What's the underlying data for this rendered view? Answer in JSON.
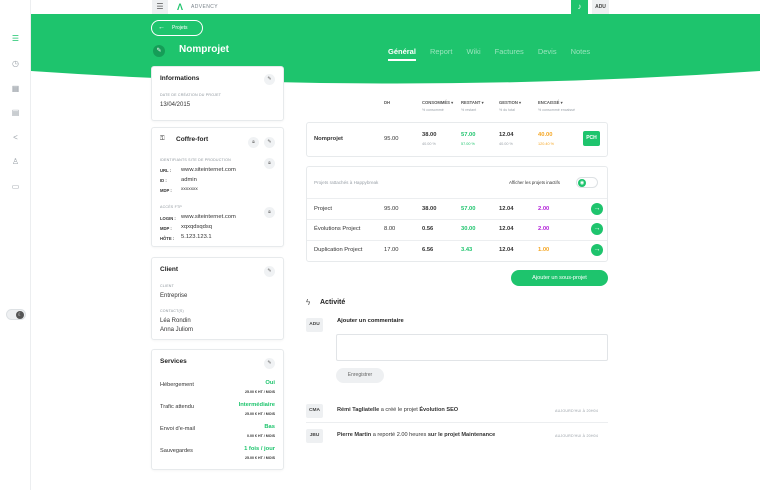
{
  "topbar": {
    "brand": "ADVENCY",
    "user_initials": "ADU"
  },
  "header": {
    "back_label": "Projets",
    "title": "Nomprojet",
    "tabs": [
      "Général",
      "Report",
      "Wiki",
      "Factures",
      "Devis",
      "Notes"
    ],
    "active_tab": "Général"
  },
  "informations": {
    "title": "Informations",
    "creation_label": "DATE DE CRÉATION DU PROJET",
    "creation_date": "13/04/2015"
  },
  "coffre": {
    "title": "Coffre-fort",
    "prod_label": "IDENTIFIANTS SITE DE PRODUCTION",
    "prod": [
      {
        "k": "URL :",
        "v": "www.siteinternet.com"
      },
      {
        "k": "ID :",
        "v": "admin"
      },
      {
        "k": "MDP :",
        "v": "xxxxxxx"
      }
    ],
    "ftp_label": "ACCÈS FTP",
    "ftp": [
      {
        "k": "LOGIN :",
        "v": "www.siteinternet.com"
      },
      {
        "k": "MDP :",
        "v": "xqxqdsqdsq"
      },
      {
        "k": "HÔTE :",
        "v": "5.123.123.1"
      }
    ]
  },
  "client": {
    "title": "Client",
    "client_label": "CLIENT",
    "client_name": "Entreprise",
    "contacts_label": "CONTACT(S)",
    "contacts": [
      "Léa Rondin",
      "Anna Juliom"
    ]
  },
  "services": {
    "title": "Services",
    "items": [
      {
        "name": "Hébergement",
        "level": "Oui",
        "price": "25.00 € HT / MOIS"
      },
      {
        "name": "Trafic attendu",
        "level": "Intermédiaire",
        "price": "25.00 € HT / MOIS"
      },
      {
        "name": "Envoi d'e-mail",
        "level": "Bas",
        "price": "0.00 € HT / MOIS"
      },
      {
        "name": "Sauvegardes",
        "level": "1 fois / jour",
        "price": "25.00 € HT / MOIS"
      }
    ]
  },
  "columns": {
    "dh": "DH",
    "consommes": "CONSOMMÉS ▾",
    "consommes_sub": "% consommé",
    "restant": "RESTANT ▾",
    "restant_sub": "% restant",
    "gestion": "GESTION ▾",
    "gestion_sub": "% du total",
    "encaisse": "ENCAISSÉ ▾",
    "encaisse_sub": "% consommé encaissé"
  },
  "main_row": {
    "name": "Nomprojet",
    "dh": "95.00",
    "consommes": "38.00",
    "consommes_pct": "40.00 %",
    "restant": "57.00",
    "restant_pct": "57.00 %",
    "gestion": "12.04",
    "gestion_pct": "40.00 %",
    "encaisse": "40.00",
    "encaisse_pct": "120.40 %",
    "badge": "PCH"
  },
  "subprojects": {
    "caption": "Projets rattachés à Happybreak",
    "show_inactive": "Afficher les projets inactifs",
    "rows": [
      {
        "name": "Project",
        "dh": "95.00",
        "consommes": "38.00",
        "restant": "57.00",
        "gestion": "12.04",
        "encaisse": "2.00"
      },
      {
        "name": "Évolutions Project",
        "dh": "8.00",
        "consommes": "0.56",
        "restant": "30.00",
        "gestion": "12.04",
        "encaisse": "2.00"
      },
      {
        "name": "Duplication Project",
        "dh": "17.00",
        "consommes": "6.56",
        "restant": "3.43",
        "gestion": "12.04",
        "encaisse": "1.00"
      }
    ],
    "add_label": "Ajouter un sous-projet"
  },
  "activity": {
    "title": "Activité",
    "comment_user": "ADU",
    "comment_title": "Ajouter un commentaire",
    "save_label": "Enregistrer",
    "logs": [
      {
        "user": "CMA",
        "actor": "Rémi Tagliatelle",
        "text": " a créé le projet ",
        "target": "Évolution SEO",
        "time": "AUJOURD'HUI À 20H04"
      },
      {
        "user": "JBU",
        "actor": "Pierre Martin",
        "text": " a reporté 2.00 heures ",
        "target": "sur le projet Maintenance",
        "time": "AUJOURD'HUI À 20H04"
      }
    ]
  },
  "colors": {
    "accent": "#1ec46d",
    "orange": "#f5a623",
    "purple": "#b11ed8"
  }
}
